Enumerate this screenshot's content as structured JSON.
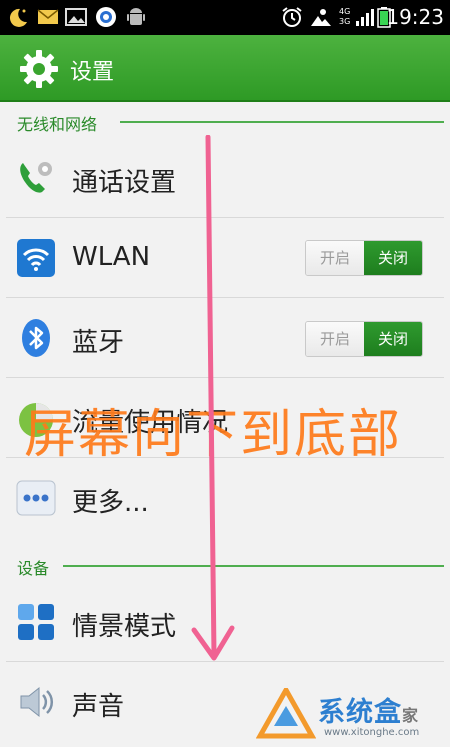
{
  "status_bar": {
    "time": "19:23",
    "network_top": "4G",
    "network_bottom": "3G",
    "icons": [
      "moon-icon",
      "mail-icon",
      "image-icon",
      "app-icon",
      "android-icon",
      "alarm-icon",
      "weather-icon",
      "signal-icon",
      "battery-icon"
    ]
  },
  "app_bar": {
    "title": "设置",
    "icon": "gear-icon"
  },
  "sections": [
    {
      "label": "无线和网络"
    },
    {
      "label": "设备"
    }
  ],
  "rows": {
    "call_settings": {
      "label": "通话设置",
      "icon": "phone-gear-icon"
    },
    "wlan": {
      "label": "WLAN",
      "icon": "wifi-icon",
      "toggle_on": "开启",
      "toggle_off": "关闭",
      "state": "off"
    },
    "bluetooth": {
      "label": "蓝牙",
      "icon": "bluetooth-icon",
      "toggle_on": "开启",
      "toggle_off": "关闭",
      "state": "off"
    },
    "data_usage": {
      "label": "流量使用情况",
      "icon": "data-usage-icon"
    },
    "more": {
      "label": "更多...",
      "icon": "more-icon"
    },
    "scene_mode": {
      "label": "情景模式",
      "icon": "grid-icon"
    },
    "sound": {
      "label": "声音",
      "icon": "speaker-icon"
    }
  },
  "overlay": {
    "text": "屏幕向下到底部"
  },
  "watermark": {
    "brand": "系统盒",
    "suffix": "家",
    "url": "www.xitonghe.com"
  },
  "colors": {
    "app_bar": "#3aa52f",
    "section_text": "#2a8a2a",
    "toggle_active": "#248a24",
    "overlay_text": "#ff7a1a",
    "arrow": "#f06292",
    "watermark": "#2d7fd0"
  }
}
